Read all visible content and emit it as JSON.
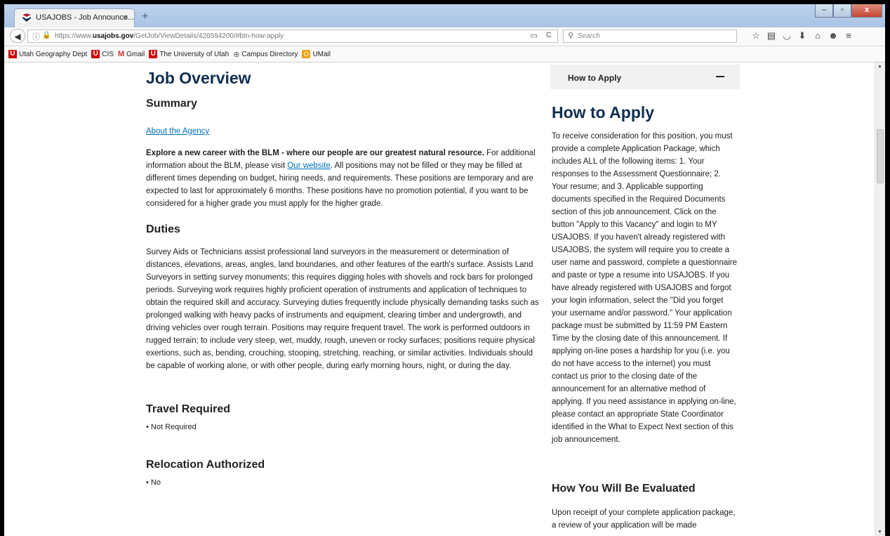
{
  "browser": {
    "tab_title": "USAJOBS - Job Announce...",
    "tab_close": "×",
    "new_tab": "+",
    "window_buttons": [
      "–",
      "▫",
      "x"
    ],
    "url_prefix": "https://www.",
    "url_domain": "usajobs.gov",
    "url_path": "/GetJob/ViewDetails/426594200/#btn-how-apply",
    "search_placeholder": "Search",
    "toolbar_icons": [
      "star-icon",
      "reading-list-icon",
      "pocket-icon",
      "download-icon",
      "home-icon",
      "chat-icon",
      "menu-icon"
    ]
  },
  "bookmarks": [
    {
      "label": "Utah Geography Dept",
      "icon": "U"
    },
    {
      "label": "CIS",
      "icon": "U"
    },
    {
      "label": "Gmail",
      "icon": "M"
    },
    {
      "label": "The University of Utah",
      "icon": "U"
    },
    {
      "label": "Campus Directory",
      "icon": "globe"
    },
    {
      "label": "UMail",
      "icon": "O"
    }
  ],
  "main": {
    "title": "Job Overview",
    "summary_heading": "Summary",
    "about_link": "About the Agency",
    "summary_bold": "Explore a new career with the BLM - where our people are our greatest natural resource.",
    "summary_text_1": " For additional information about the BLM, please visit ",
    "summary_link": "Our website",
    "summary_text_2": ". All positions may not be filled or they may be filled at different times depending on budget, hiring needs, and requirements. These positions are temporary and are expected to last for approximately 6 months. These positions have no promotion potential, if you want to be considered for a higher grade you must apply for the higher grade.",
    "duties_heading": "Duties",
    "duties_text": "Survey Aids or Technicians assist professional land surveyors in the measurement or determination of distances, elevations, areas, angles, land boundaries, and other features of the earth's surface. Assists Land Surveyors in setting survey monuments; this requires digging holes with shovels and rock bars for prolonged periods. Surveying work requires highly proficient operation of instruments and application of techniques to obtain the required skill and accuracy. Surveying duties frequently include physically demanding tasks such as prolonged walking with heavy packs of instruments and equipment, clearing timber and undergrowth, and driving vehicles over rough terrain. Positions may require frequent travel. The work is performed outdoors in rugged terrain; to include very steep, wet, muddy, rough, uneven or rocky surfaces; positions require physical exertions, such as, bending, crouching, stooping, stretching, reaching, or similar activities. Individuals should be capable of working alone, or with other people, during early morning hours, night, or during the day.",
    "travel_heading": "Travel Required",
    "travel_value": "• Not Required",
    "relocation_heading": "Relocation Authorized",
    "relocation_value": "• No"
  },
  "sidebar": {
    "accordion_label": "How to Apply",
    "heading": "How to Apply",
    "apply_text": "To receive consideration for this position, you must provide a complete Application Package, which includes ALL of the following items: 1. Your responses to the Assessment Questionnaire; 2. Your resume; and 3. Applicable supporting documents specified in the Required Documents section of this job announcement. Click on the button \"Apply to this Vacancy\" and login to MY USAJOBS. If you haven't already registered with USAJOBS, the system will require you to create a user name and password, complete a questionnaire and paste or type a resume into USAJOBS. If you have already registered with USAJOBS and forgot your login information, select the \"Did you forget your username and/or password.\" Your application package must be submitted by 11:59 PM Eastern Time by the closing date of this announcement. If applying on-line poses a hardship for you (i.e. you do not have access to the internet) you must contact us prior to the closing date of the announcement for an alternative method of applying. If you need assistance in applying on-line, please contact an appropriate State Coordinator identified in the What to Expect Next section of this job announcement.",
    "evaluated_heading": "How You Will Be Evaluated",
    "evaluated_text": "Upon receipt of your complete application package, a review of your application will be made"
  }
}
